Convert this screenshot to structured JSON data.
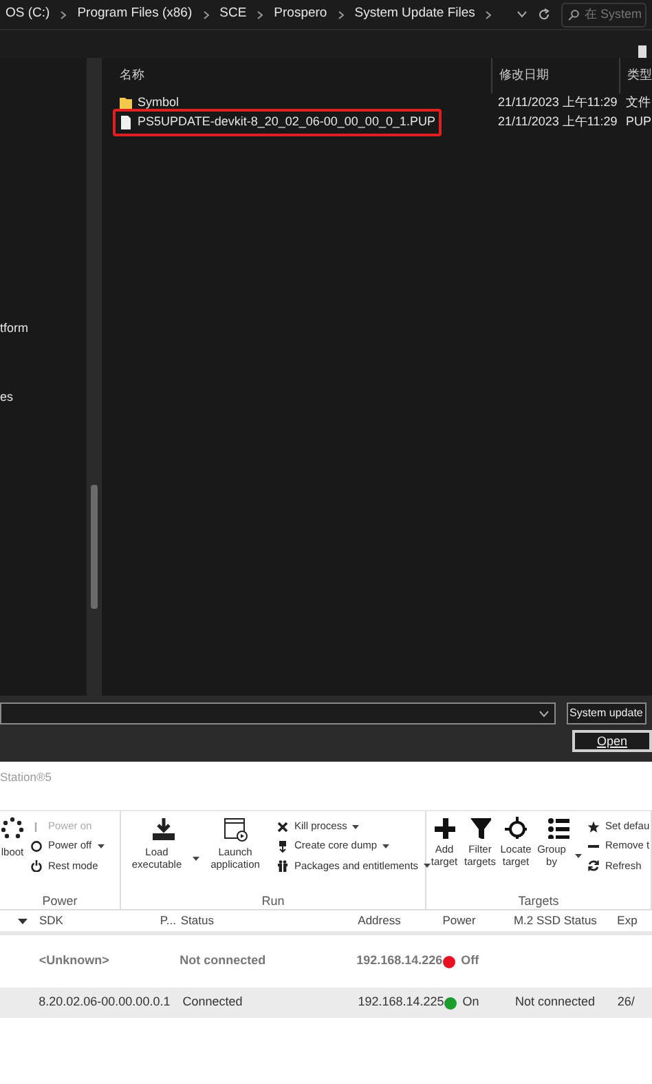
{
  "address_bar": {
    "breadcrumbs": [
      "OS (C:)",
      "Program Files (x86)",
      "SCE",
      "Prospero",
      "System Update Files"
    ],
    "search": {
      "placeholder": "在 System"
    }
  },
  "navigation_pane": {
    "items": [
      "tform",
      "es"
    ]
  },
  "file_list": {
    "columns": [
      "名称",
      "修改日期",
      "类型"
    ],
    "rows": [
      {
        "name": "Symbol",
        "kind": "folder",
        "modified": "21/11/2023 上午11:29",
        "type": "文件",
        "highlighted": false
      },
      {
        "name": "PS5UPDATE-devkit-8_20_02_06-00_00_00_0_1.PUP",
        "kind": "file",
        "modified": "21/11/2023 上午11:29",
        "type": "PUP",
        "highlighted": true
      }
    ]
  },
  "file_type_filter": {
    "value": "System update"
  },
  "open_button": "Open",
  "app": {
    "title": "Station®5",
    "ribbon": [
      {
        "label": "Power",
        "large": [
          {
            "label": "lboot",
            "dropdown": false
          }
        ],
        "small": [
          {
            "label": "Power on",
            "dropdown": false,
            "disabled": true
          },
          {
            "label": "Power off",
            "dropdown": true,
            "disabled": false
          },
          {
            "label": "Rest mode",
            "dropdown": false,
            "disabled": false
          }
        ]
      },
      {
        "label": "Run",
        "large": [
          {
            "label": "Load executable",
            "dropdown": true
          },
          {
            "label": "Launch application",
            "dropdown": false
          }
        ],
        "small": [
          {
            "label": "Kill process",
            "dropdown": true,
            "disabled": false
          },
          {
            "label": "Create core dump",
            "dropdown": true,
            "disabled": false
          },
          {
            "label": "Packages and entitlements",
            "dropdown": true,
            "disabled": false
          }
        ]
      },
      {
        "label": "Targets",
        "large": [
          {
            "label": "Add target",
            "dropdown": false
          },
          {
            "label": "Filter targets",
            "dropdown": false
          },
          {
            "label": "Locate target",
            "dropdown": false
          },
          {
            "label": "Group by",
            "dropdown": true
          }
        ],
        "small": [
          {
            "label": "Set defau",
            "dropdown": false,
            "disabled": false
          },
          {
            "label": "Remove t",
            "dropdown": false,
            "disabled": false
          },
          {
            "label": "Refresh",
            "dropdown": false,
            "disabled": false
          }
        ]
      }
    ],
    "table": {
      "columns": [
        "SDK",
        "P...",
        "Status",
        "Address",
        "Power",
        "M.2 SSD Status",
        "Exp"
      ],
      "rows": [
        {
          "sdk": "<Unknown>",
          "status": "Not connected",
          "address": "192.168.14.226",
          "power": "Off",
          "color": "#e81123",
          "connected": false,
          "selected": false
        },
        {
          "sdk": "8.20.02.06-00.00.00.0.1",
          "status": "Connected",
          "address": "192.168.14.225",
          "power": "On",
          "color": "#1e9c2e",
          "ssd_status": "Not connected",
          "expiry": "26/",
          "connected": true,
          "selected": true
        }
      ]
    }
  }
}
